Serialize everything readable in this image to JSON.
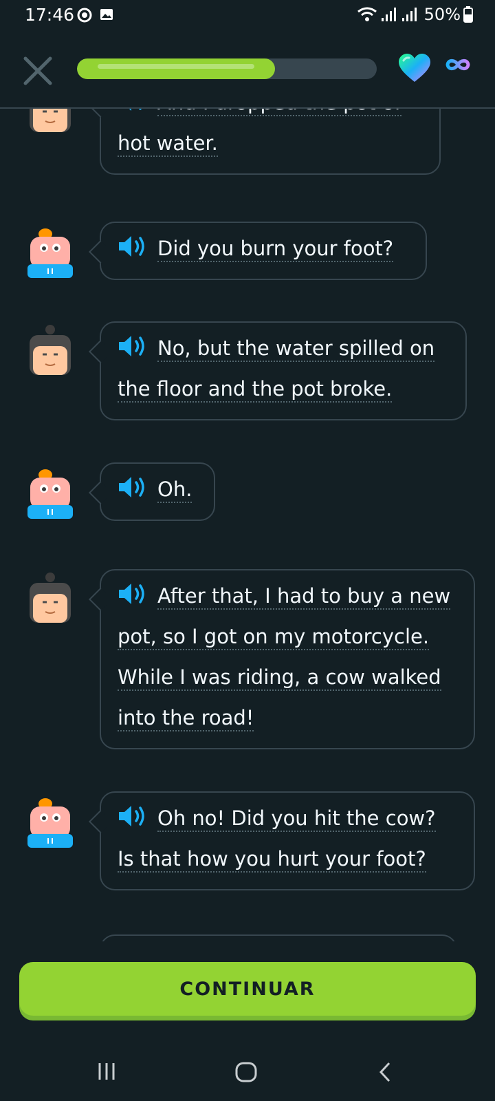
{
  "status_bar": {
    "time": "17:46",
    "battery_percent": "50%",
    "icons": [
      "gear-notification-icon",
      "image-notification-icon",
      "wifi-icon",
      "signal-icon",
      "signal-icon",
      "battery-icon"
    ]
  },
  "lesson_header": {
    "progress_fraction": 0.66,
    "hearts_icon": "gradient-heart-icon",
    "hearts_value_icon": "infinity-icon"
  },
  "conversation": {
    "messages": [
      {
        "speaker": "man",
        "text": "And I dropped the pot of hot water."
      },
      {
        "speaker": "lily",
        "text": "Did you burn your foot?"
      },
      {
        "speaker": "man",
        "text": "No, but the water spilled on the floor and the pot broke."
      },
      {
        "speaker": "lily",
        "text": "Oh."
      },
      {
        "speaker": "man",
        "text": "After that, I had to buy a new pot, so I got on my motorcycle. While I was riding, a cow walked into the road!"
      },
      {
        "speaker": "lily",
        "text": "Oh no! Did you hit the cow? Is that how you hurt your foot?"
      }
    ]
  },
  "footer": {
    "continue_label": "CONTINUAR"
  },
  "colors": {
    "background": "#131f24",
    "bubble_border": "#37464f",
    "accent_green": "#93d333",
    "speaker_blue": "#1cb0f6"
  }
}
